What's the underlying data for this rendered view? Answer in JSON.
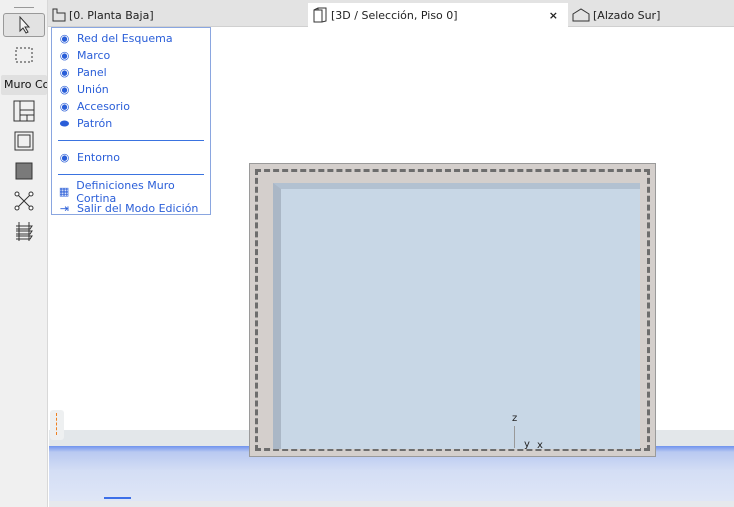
{
  "toolbox": {
    "muro_label": "Muro Co"
  },
  "tabs": [
    {
      "label": "[0. Planta Baja]"
    },
    {
      "label": "[3D / Selección, Piso 0]",
      "close": "×"
    },
    {
      "label": "[Alzado Sur]"
    }
  ],
  "menu": {
    "items": [
      {
        "label": "Red del Esquema",
        "icon": "eye-icon"
      },
      {
        "label": "Marco",
        "icon": "eye-icon"
      },
      {
        "label": "Panel",
        "icon": "eye-icon"
      },
      {
        "label": "Unión",
        "icon": "eye-icon"
      },
      {
        "label": "Accesorio",
        "icon": "eye-icon"
      },
      {
        "label": "Patrón",
        "icon": "eye-closed-icon"
      }
    ],
    "entorno": "Entorno",
    "definiciones": "Definiciones Muro Cortina",
    "salir": "Salir del Modo Edición"
  },
  "axis": {
    "z": "z",
    "y": "y",
    "x": "x"
  },
  "colors": {
    "menu_text": "#2a5ed8",
    "glass": "#c8d7e6",
    "ground": "#6f92ee"
  }
}
